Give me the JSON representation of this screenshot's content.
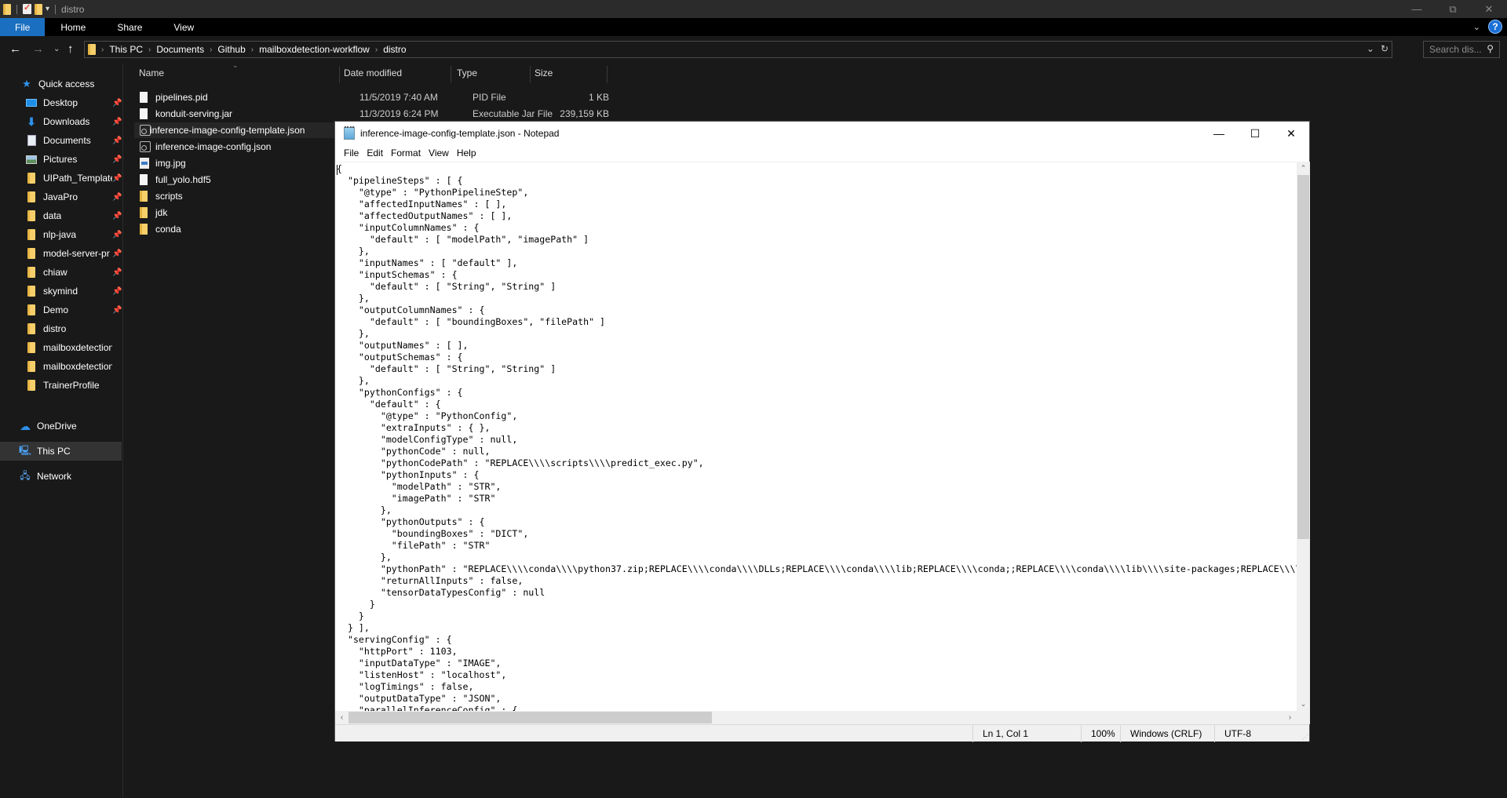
{
  "explorer": {
    "window_title": "distro",
    "window_controls": {
      "minimize": "—",
      "restore": "⧉",
      "close": "✕"
    },
    "ribbon_tabs": [
      "File",
      "Home",
      "Share",
      "View"
    ],
    "breadcrumb": [
      "This PC",
      "Documents",
      "Github",
      "mailboxdetection-workflow",
      "distro"
    ],
    "search_placeholder": "Search dis...",
    "nav": {
      "quick_access": "Quick access",
      "items": [
        {
          "label": "Desktop",
          "icon": "desktop-icon",
          "pinned": true
        },
        {
          "label": "Downloads",
          "icon": "downloads-icon",
          "pinned": true
        },
        {
          "label": "Documents",
          "icon": "documents-icon",
          "pinned": true
        },
        {
          "label": "Pictures",
          "icon": "pictures-icon",
          "pinned": true
        },
        {
          "label": "UIPath_Template",
          "icon": "folder-icon",
          "pinned": true
        },
        {
          "label": "JavaPro",
          "icon": "folder-icon",
          "pinned": true
        },
        {
          "label": "data",
          "icon": "folder-icon",
          "pinned": true
        },
        {
          "label": "nlp-java",
          "icon": "folder-icon",
          "pinned": true
        },
        {
          "label": "model-server-pr",
          "icon": "folder-icon",
          "pinned": true
        },
        {
          "label": "chiaw",
          "icon": "folder-icon",
          "pinned": true
        },
        {
          "label": "skymind",
          "icon": "folder-icon",
          "pinned": true
        },
        {
          "label": "Demo",
          "icon": "folder-icon",
          "pinned": true
        },
        {
          "label": "distro",
          "icon": "folder-icon",
          "pinned": false
        },
        {
          "label": "mailboxdetection-v",
          "icon": "folder-icon",
          "pinned": false
        },
        {
          "label": "mailboxdetection-v",
          "icon": "folder-icon",
          "pinned": false
        },
        {
          "label": "TrainerProfile",
          "icon": "folder-icon",
          "pinned": false
        }
      ],
      "onedrive": "OneDrive",
      "this_pc": "This PC",
      "network": "Network"
    },
    "columns": [
      "Name",
      "Date modified",
      "Type",
      "Size"
    ],
    "files": [
      {
        "name": "pipelines.pid",
        "date": "11/5/2019 7:40 AM",
        "type": "PID File",
        "size": "1 KB",
        "icon": "file-icon"
      },
      {
        "name": "konduit-serving.jar",
        "date": "11/3/2019 6:24 PM",
        "type": "Executable Jar File",
        "size": "239,159 KB",
        "icon": "file-icon"
      },
      {
        "name": "inference-image-config-template.json",
        "date": "",
        "type": "",
        "size": "",
        "icon": "json-file-icon"
      },
      {
        "name": "inference-image-config.json",
        "date": "",
        "type": "",
        "size": "",
        "icon": "json-file-icon"
      },
      {
        "name": "img.jpg",
        "date": "",
        "type": "",
        "size": "",
        "icon": "image-file-icon"
      },
      {
        "name": "full_yolo.hdf5",
        "date": "",
        "type": "",
        "size": "",
        "icon": "file-icon"
      },
      {
        "name": "scripts",
        "date": "",
        "type": "",
        "size": "",
        "icon": "folder-icon"
      },
      {
        "name": "jdk",
        "date": "",
        "type": "",
        "size": "",
        "icon": "folder-icon"
      },
      {
        "name": "conda",
        "date": "",
        "type": "",
        "size": "",
        "icon": "folder-icon"
      }
    ]
  },
  "notepad": {
    "title": "inference-image-config-template.json - Notepad",
    "window_controls": {
      "minimize": "—",
      "maximize": "☐",
      "close": "✕"
    },
    "menu": [
      "File",
      "Edit",
      "Format",
      "View",
      "Help"
    ],
    "content": "{\n  \"pipelineSteps\" : [ {\n    \"@type\" : \"PythonPipelineStep\",\n    \"affectedInputNames\" : [ ],\n    \"affectedOutputNames\" : [ ],\n    \"inputColumnNames\" : {\n      \"default\" : [ \"modelPath\", \"imagePath\" ]\n    },\n    \"inputNames\" : [ \"default\" ],\n    \"inputSchemas\" : {\n      \"default\" : [ \"String\", \"String\" ]\n    },\n    \"outputColumnNames\" : {\n      \"default\" : [ \"boundingBoxes\", \"filePath\" ]\n    },\n    \"outputNames\" : [ ],\n    \"outputSchemas\" : {\n      \"default\" : [ \"String\", \"String\" ]\n    },\n    \"pythonConfigs\" : {\n      \"default\" : {\n        \"@type\" : \"PythonConfig\",\n        \"extraInputs\" : { },\n        \"modelConfigType\" : null,\n        \"pythonCode\" : null,\n        \"pythonCodePath\" : \"REPLACE\\\\\\\\scripts\\\\\\\\predict_exec.py\",\n        \"pythonInputs\" : {\n          \"modelPath\" : \"STR\",\n          \"imagePath\" : \"STR\"\n        },\n        \"pythonOutputs\" : {\n          \"boundingBoxes\" : \"DICT\",\n          \"filePath\" : \"STR\"\n        },\n        \"pythonPath\" : \"REPLACE\\\\\\\\conda\\\\\\\\python37.zip;REPLACE\\\\\\\\conda\\\\\\\\DLLs;REPLACE\\\\\\\\conda\\\\\\\\lib;REPLACE\\\\\\\\conda;;REPLACE\\\\\\\\conda\\\\\\\\lib\\\\\\\\site-packages;REPLACE\\\\\\\\conda\\\\\\\\lib\\\\\\\\site-pac\n        \"returnAllInputs\" : false,\n        \"tensorDataTypesConfig\" : null\n      }\n    }\n  } ],\n  \"servingConfig\" : {\n    \"httpPort\" : 1103,\n    \"inputDataType\" : \"IMAGE\",\n    \"listenHost\" : \"localhost\",\n    \"logTimings\" : false,\n    \"outputDataType\" : \"JSON\",\n    \"parallelInferenceConfig\" : {",
    "status": {
      "position": "Ln 1, Col 1",
      "zoom": "100%",
      "line_ending": "Windows (CRLF)",
      "encoding": "UTF-8"
    }
  }
}
